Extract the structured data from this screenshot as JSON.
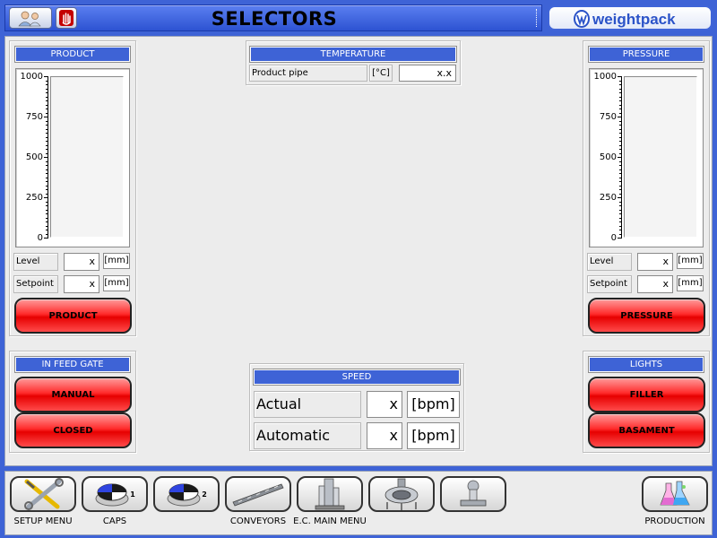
{
  "header": {
    "title": "SELECTORS",
    "logo_text": "weightpack"
  },
  "product": {
    "title": "PRODUCT",
    "axis_ticks": [
      "1000",
      "750",
      "500",
      "250",
      "0"
    ],
    "level_label": "Level",
    "level_value": "x",
    "level_unit": "[mm]",
    "setpoint_label": "Setpoint",
    "setpoint_value": "x",
    "setpoint_unit": "[mm]",
    "button_label": "PRODUCT"
  },
  "temperature": {
    "title": "TEMPERATURE",
    "row_label": "Product pipe",
    "unit": "[°C]",
    "value": "x.x"
  },
  "pressure": {
    "title": "PRESSURE",
    "axis_ticks": [
      "1000",
      "750",
      "500",
      "250",
      "0"
    ],
    "level_label": "Level",
    "level_value": "x",
    "level_unit": "[mm]",
    "setpoint_label": "Setpoint",
    "setpoint_value": "x",
    "setpoint_unit": "[mm]",
    "button_label": "PRESSURE"
  },
  "infeed_gate": {
    "title": "IN FEED GATE",
    "btn1": "MANUAL",
    "btn2": "CLOSED"
  },
  "speed": {
    "title": "SPEED",
    "actual_label": "Actual",
    "actual_value": "x",
    "actual_unit": "[bpm]",
    "automatic_label": "Automatic",
    "automatic_value": "x",
    "automatic_unit": "[bpm]"
  },
  "lights": {
    "title": "LIGHTS",
    "btn1": "FILLER",
    "btn2": "BASAMENT"
  },
  "footer": {
    "setup_label": "SETUP MENU",
    "caps_label": "CAPS",
    "cap1_num": "1",
    "cap2_num": "2",
    "conveyors_label": "CONVEYORS",
    "ec_main_label": "E.C. MAIN MENU",
    "production_label": "PRODUCTION"
  },
  "colors": {
    "brand_blue": "#3e63d6",
    "button_red": "#ff2b2b"
  }
}
